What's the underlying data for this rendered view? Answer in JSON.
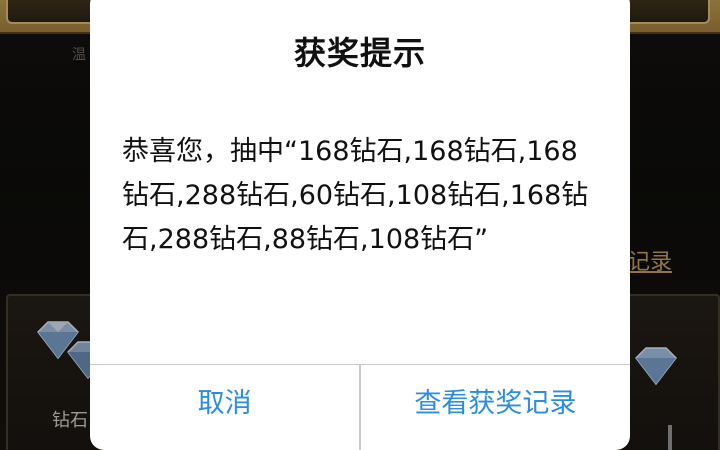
{
  "background": {
    "partial_left_label": "温",
    "record_link": "记录",
    "panel_label": "钻石"
  },
  "dialog": {
    "title": "获奖提示",
    "message": "恭喜您，抽中“168钻石,168钻石,168钻石,288钻石,60钻石,108钻石,168钻石,288钻石,88钻石,108钻石”",
    "buttons": {
      "cancel": "取消",
      "view_records": "查看获奖记录"
    }
  },
  "colors": {
    "button_text": "#2a8de0",
    "dialog_bg": "#ffffff",
    "title": "#111111"
  },
  "icons": [
    "diamond-icon"
  ]
}
